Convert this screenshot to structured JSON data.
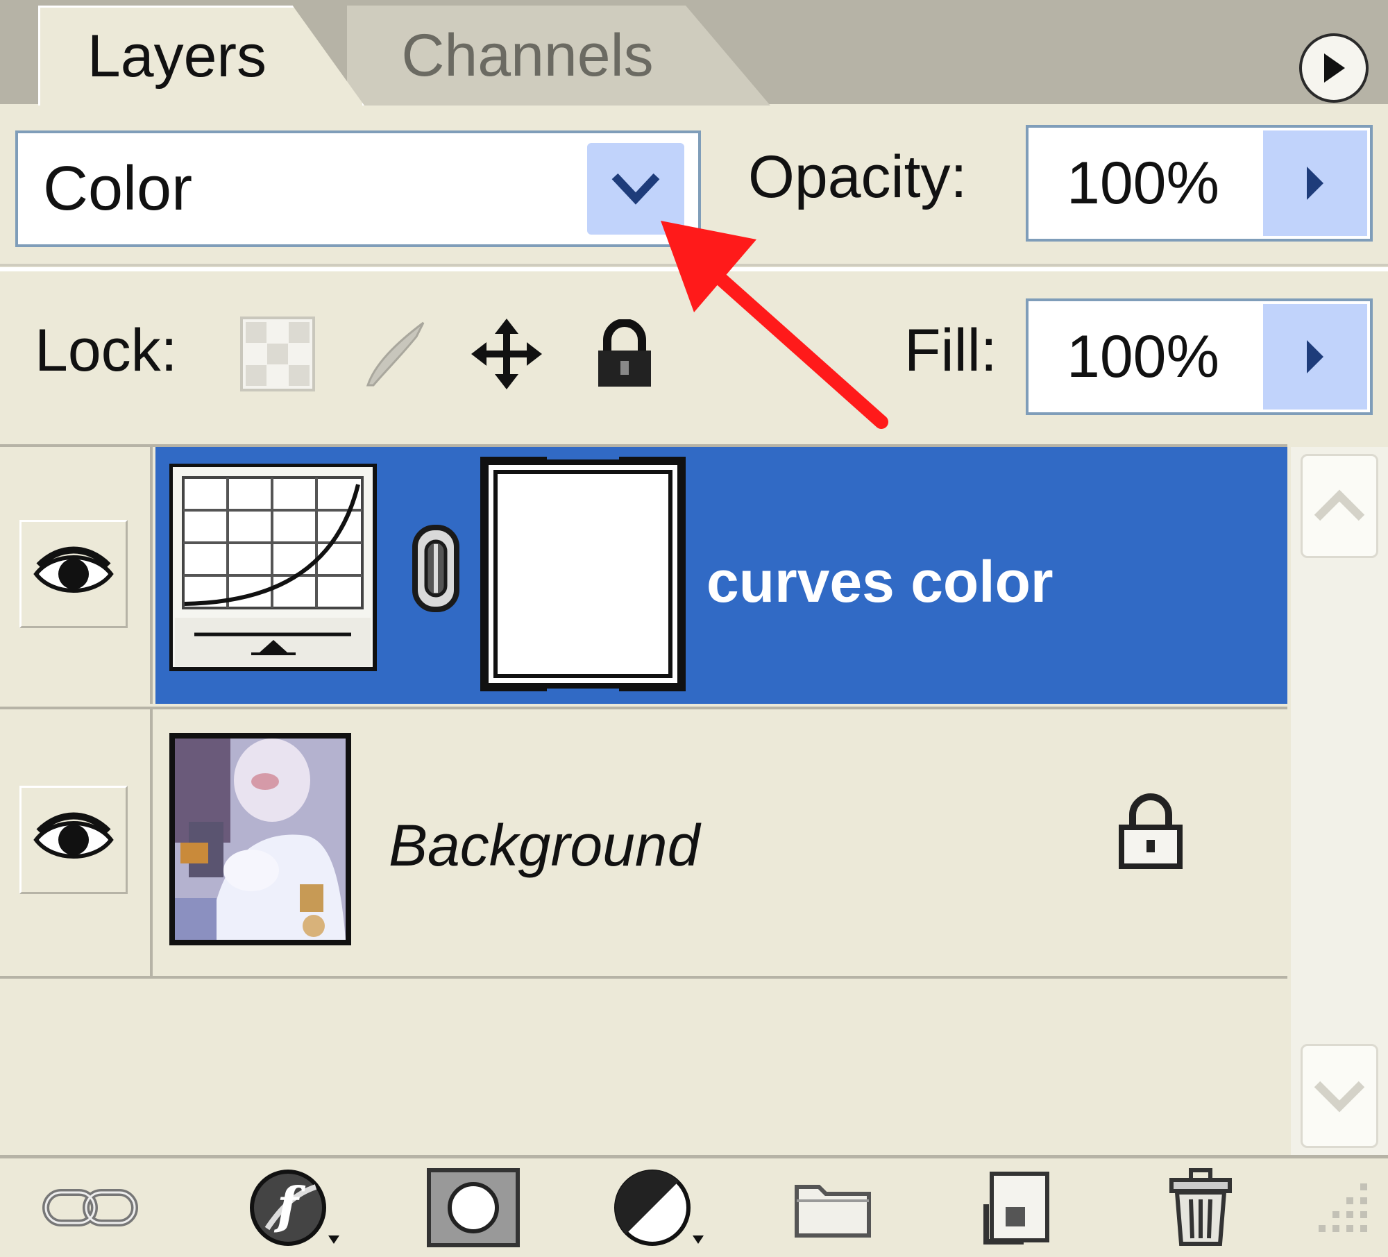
{
  "tabs": [
    {
      "label": "Layers",
      "active": true
    },
    {
      "label": "Channels",
      "active": false
    }
  ],
  "blend_mode": {
    "value": "Color"
  },
  "opacity": {
    "label": "Opacity:",
    "value": "100%"
  },
  "fill": {
    "label": "Fill:",
    "value": "100%"
  },
  "lock": {
    "label": "Lock:"
  },
  "layers": [
    {
      "name": "curves color",
      "selected": true,
      "visible": true,
      "type": "curves-adjustment"
    },
    {
      "name": "Background",
      "selected": false,
      "visible": true,
      "locked": true
    }
  ],
  "colors": {
    "panel_bg": "#ece9d8",
    "selection": "#316ac5",
    "field_border": "#7f9db9",
    "dropdown_button": "#c1d3fb",
    "annotation_arrow": "#ff1a1a"
  },
  "icons": {
    "lock_options": [
      "lock-transparency-icon",
      "lock-image-icon",
      "lock-position-icon",
      "lock-all-icon"
    ],
    "bottom_toolbar": [
      "link-layers-icon",
      "layer-style-icon",
      "layer-mask-icon",
      "adjustment-layer-icon",
      "new-group-icon",
      "new-layer-icon",
      "delete-layer-icon"
    ]
  }
}
